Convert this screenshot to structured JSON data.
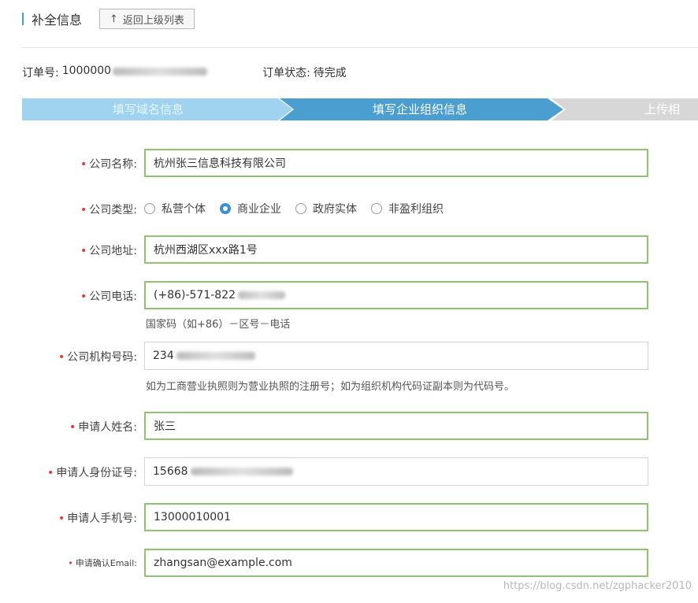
{
  "header": {
    "title": "补全信息",
    "back_label": "返回上级列表",
    "back_icon": "up-arrow-icon"
  },
  "order": {
    "number_label": "订单号:",
    "number_value": "1000000",
    "status_label": "订单状态:",
    "status_value": "待完成"
  },
  "steps": [
    {
      "label": "填写域名信息",
      "state": "done"
    },
    {
      "label": "填写企业组织信息",
      "state": "active"
    },
    {
      "label": "上传相",
      "state": "pending"
    }
  ],
  "colors": {
    "step_done": "#9fd3ef",
    "step_active": "#4a9fd0",
    "step_pending": "#d7d7d7",
    "valid_border": "#8cc56a",
    "required": "#e33333"
  },
  "form": {
    "company_name": {
      "label": "公司名称:",
      "value": "杭州张三信息科技有限公司"
    },
    "company_type": {
      "label": "公司类型:",
      "options": [
        "私营个体",
        "商业企业",
        "政府实体",
        "非盈利组织"
      ],
      "selected": "商业企业"
    },
    "company_address": {
      "label": "公司地址:",
      "value": "杭州西湖区xxx路1号"
    },
    "company_phone": {
      "label": "公司电话:",
      "value": "(+86)-571-822",
      "hint": "国家码（如+86）－区号－电话"
    },
    "org_code": {
      "label": "公司机构号码:",
      "value": "234",
      "hint": "如为工商营业执照则为营业执照的注册号；如为组织机构代码证副本则为代码号。"
    },
    "applicant_name": {
      "label": "申请人姓名:",
      "value": "张三"
    },
    "applicant_id": {
      "label": "申请人身份证号:",
      "value": "15668"
    },
    "applicant_mobile": {
      "label": "申请人手机号:",
      "value": "13000010001"
    },
    "applicant_email": {
      "label": "申请确认Email:",
      "value": "zhangsan@example.com"
    }
  },
  "watermark": "https://blog.csdn.net/zgphacker2010"
}
